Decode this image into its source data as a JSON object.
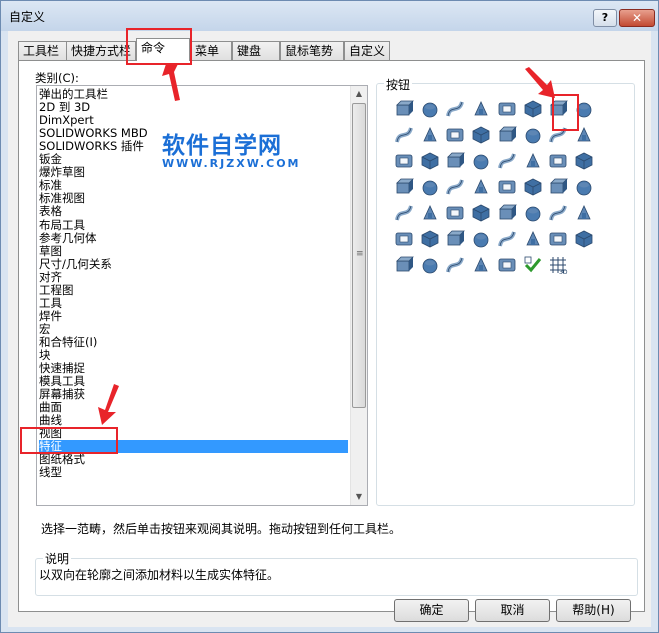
{
  "window": {
    "title": "自定义",
    "help_label": "?",
    "close_label": "✕"
  },
  "tabs": [
    {
      "label": "工具栏",
      "active": false
    },
    {
      "label": "快捷方式栏",
      "active": false
    },
    {
      "label": "命令",
      "active": true
    },
    {
      "label": "菜单",
      "active": false
    },
    {
      "label": "键盘",
      "active": false
    },
    {
      "label": "鼠标笔势",
      "active": false
    },
    {
      "label": "自定义",
      "active": false
    }
  ],
  "categories": {
    "label": "类别(C):",
    "selected": "特征",
    "items": [
      "弹出的工具栏",
      "2D 到 3D",
      "DimXpert",
      "SOLIDWORKS MBD",
      "SOLIDWORKS 插件",
      "钣金",
      "爆炸草图",
      "标准",
      "标准视图",
      "表格",
      "布局工具",
      "参考几何体",
      "草图",
      "尺寸/几何关系",
      "对齐",
      "工程图",
      "工具",
      "焊件",
      "宏",
      "和合特征(I)",
      "块",
      "快速捕捉",
      "模具工具",
      "屏幕捕获",
      "曲面",
      "曲线",
      "视图",
      "特征",
      "图纸格式",
      "线型"
    ]
  },
  "buttons_panel": {
    "label": "按钮",
    "icons": [
      "extruded-boss-icon",
      "revolved-boss-icon",
      "swept-boss-icon",
      "lofted-boss-icon",
      "boundary-boss-icon",
      "extruded-cut-icon",
      "lofted-cut-icon",
      "revolved-cut-icon",
      "swept-cut-icon",
      "hole-wizard-icon",
      "fillet-icon",
      "chamfer-icon",
      "rib-icon",
      "shell-icon",
      "draft-icon",
      "dome-icon",
      "linear-pattern-icon",
      "mirror-icon",
      "wrap-icon",
      "intersect-icon",
      "scale-icon",
      "combine-icon",
      "thicken-icon",
      "indent-icon",
      "move-face-icon",
      "deform-icon",
      "flex-icon",
      "freeform-icon",
      "split-icon",
      "delete-body-icon",
      "move-copy-body-icon",
      "circular-pattern-icon",
      "curve-pattern-icon",
      "sketch-pattern-icon",
      "table-pattern-icon",
      "fill-pattern-icon",
      "variable-pattern-icon",
      "cosmetic-thread-icon",
      "mirror-body-icon",
      "linear-mirror-icon",
      "reference-point-icon",
      "table-driven-icon",
      "library-feature-icon",
      "sheet-feature-icon",
      "imported-icon",
      "fastening-icon",
      "vent-icon",
      "lip-groove-icon",
      "snap-hook-icon",
      "curve-driven-icon",
      "motion-icon",
      "instant3d-icon",
      "feature-works-icon",
      "check-icon",
      "grid-3d-icon"
    ]
  },
  "hint_text": "选择一范畴，然后单击按钮来观阅其说明。拖动按钮到任何工具栏。",
  "description": {
    "label": "说明",
    "text": "以双向在轮廓之间添加材料以生成实体特征。"
  },
  "dialog_buttons": {
    "ok": "确定",
    "cancel": "取消",
    "help": "帮助(H)"
  },
  "watermark": {
    "title": "软件自学网",
    "url": "WWW.RJZXW.COM"
  },
  "colors": {
    "accent": "#3399ff",
    "annotation": "#e8242a",
    "watermark": "#1b6fd6"
  }
}
